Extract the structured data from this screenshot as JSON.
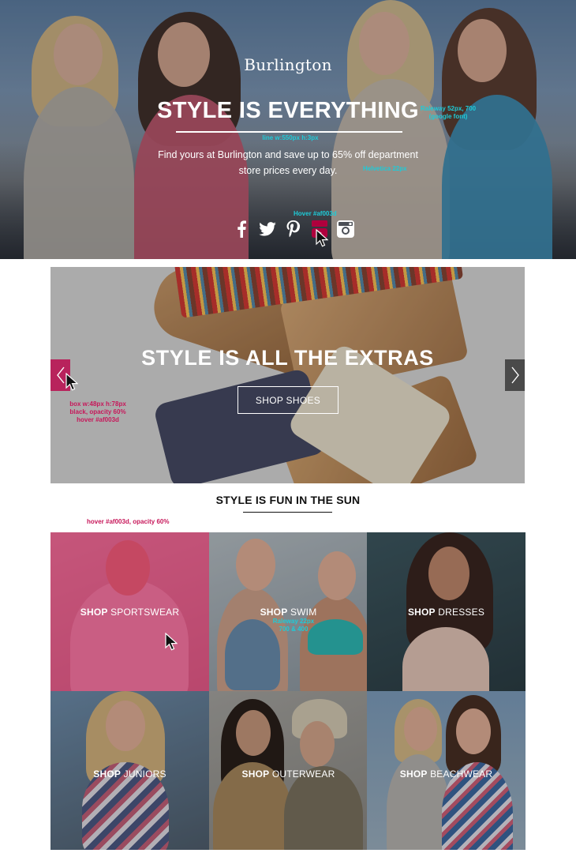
{
  "hero": {
    "logo": "Burlington",
    "title": "STYLE IS EVERYTHING",
    "subtitle": "Find yours at Burlington and save up to 65% off department store prices every day.",
    "annotations": {
      "title_font": "Raleway 52px, 700",
      "title_font_2": "(google font)",
      "line_spec": "line w:550px h:3px",
      "subtitle_font": "Helvetica 22px",
      "hover_social": "Hover #af003d"
    },
    "social": [
      {
        "icon": "facebook-icon"
      },
      {
        "icon": "twitter-icon"
      },
      {
        "icon": "pinterest-icon"
      },
      {
        "icon": "youtube-icon"
      },
      {
        "icon": "instagram-icon"
      }
    ],
    "hover_color": "#af003d"
  },
  "slider": {
    "title": "STYLE IS ALL THE EXTRAS",
    "cta": "SHOP SHOES",
    "annotations": {
      "arrow_box_1": "box w:48px h:78px",
      "arrow_box_2": "black, opacity 60%",
      "arrow_box_3": "hover #af003d"
    },
    "prev_icon": "chevron-left-icon",
    "next_icon": "chevron-right-icon"
  },
  "section": {
    "title_strong": "STYLE IS FUN",
    "title_rest": " IN THE SUN",
    "annotation": "hover #af003d, opacity 60%"
  },
  "tiles": [
    {
      "prefix": "SHOP",
      "label": " SPORTSWEAR"
    },
    {
      "prefix": "SHOP",
      "label": " SWIM",
      "note_1": "Raleway 22px",
      "note_2": "700 & 400"
    },
    {
      "prefix": "SHOP",
      "label": " DRESSES"
    },
    {
      "prefix": "SHOP",
      "label": " JUNIORS"
    },
    {
      "prefix": "SHOP",
      "label": " OUTERWEAR"
    },
    {
      "prefix": "SHOP",
      "label": " BEACHWEAR"
    }
  ],
  "colors": {
    "accent": "#af003d",
    "annotation_cyan": "#1ecbd8",
    "annotation_pink": "#c7175a"
  }
}
